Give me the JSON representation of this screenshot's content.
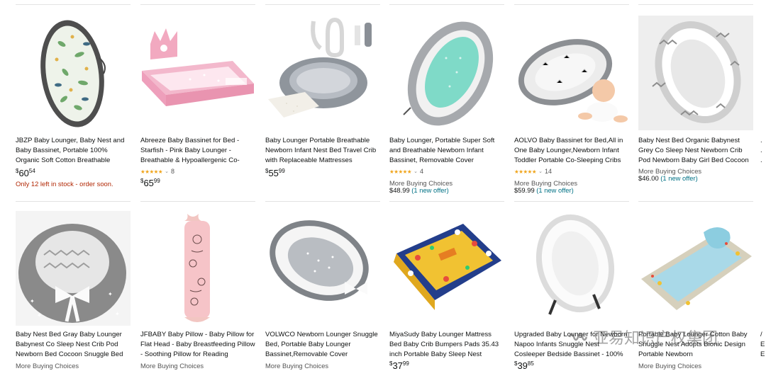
{
  "products_row1": [
    {
      "title": "JBZP Baby Lounger, Baby Nest and Baby Bassinet, Portable 100% Organic Soft Cotton Breathable",
      "price_currency": "$",
      "price_whole": "60",
      "price_fraction": "54",
      "stock_note": "Only 12 left in stock - order soon.",
      "image_icon": "baby-nest-leaf-print-icon"
    },
    {
      "title": "Abreeze Baby Bassinet for Bed - Starfish - Pink Baby Lounger - Breathable & Hypoallergenic Co-",
      "rating_stars": "★★★★★",
      "rating_count": "8",
      "price_currency": "$",
      "price_whole": "65",
      "price_fraction": "99",
      "image_icon": "pink-crown-bassinet-icon"
    },
    {
      "title": "Baby Lounger Portable Breathable Newborn Infant Nest Bed Travel Crib with Replaceable Mattresses",
      "price_currency": "$",
      "price_whole": "55",
      "price_fraction": "99",
      "image_icon": "gray-lounger-set-icon"
    },
    {
      "title": "Baby Lounger, Portable Super Soft and Breathable Newborn Infant Bassinet, Removable Cover",
      "rating_stars": "★★★★★",
      "rating_count": "4",
      "more_buying": "More Buying Choices",
      "mbc_price": "$48.99",
      "mbc_offer": "(1 new offer)",
      "image_icon": "mint-lounger-icon"
    },
    {
      "title": "AOLVO Baby Bassinet for Bed,All in One Baby Lounger,Newborn Infant Toddler Portable Co-Sleeping Cribs",
      "rating_stars": "★★★★★",
      "rating_count": "14",
      "more_buying": "More Buying Choices",
      "mbc_price": "$59.99",
      "mbc_offer": "(1 new offer)",
      "image_icon": "baby-in-lounger-icon"
    },
    {
      "title": "Baby Nest Bed Organic Babynest Grey Co Sleep Nest Newborn Crib Pod Newborn Baby Girl Bed Cocoon",
      "more_buying": "More Buying Choices",
      "mbc_price": "$46.00",
      "mbc_offer": "(1 new offer)",
      "image_icon": "chevron-nest-icon"
    }
  ],
  "products_row2": [
    {
      "title": "Baby Nest Bed Gray Baby Lounger Babynest Co Sleep Nest Crib Pod Newborn Bed Cocoon Snuggle Bed",
      "more_buying": "More Buying Choices",
      "image_icon": "gray-star-nest-bow-icon"
    },
    {
      "title": "JFBABY Baby Pillow - Baby Pillow for Flat Head - Baby Breastfeeding Pillow - Soothing Pillow for Reading",
      "more_buying": "More Buying Choices",
      "image_icon": "pink-roll-pillow-icon"
    },
    {
      "title": "VOLWCO Newborn Lounger Snuggle Bed, Portable Baby Lounger Bassinet,Removable Cover",
      "more_buying": "More Buying Choices",
      "image_icon": "gray-dot-nest-icon"
    },
    {
      "title": "MiyaSudy Baby Lounger Mattress Bed Baby Crib Bumpers Pads 35.43 inch Portable Baby Sleep Nest",
      "price_currency": "$",
      "price_whole": "37",
      "price_fraction": "99",
      "image_icon": "colorful-crib-bumper-icon"
    },
    {
      "title": "Upgraded Baby Lounger for Newborn Napoo Infants Snuggle Nest Cosleeper Bedside Bassinet - 100%",
      "price_currency": "$",
      "price_whole": "39",
      "price_fraction": "85",
      "image_icon": "white-nest-icon"
    },
    {
      "title": "Portable Baby Lounger Cotton Baby Snuggle Nest Adopts Bionic Design Portable Newborn",
      "more_buying": "More Buying Choices",
      "image_icon": "blue-lounger-pillow-icon"
    }
  ],
  "watermark": {
    "text": "亚易知识产权集团",
    "icon": "wechat-channel-icon"
  }
}
